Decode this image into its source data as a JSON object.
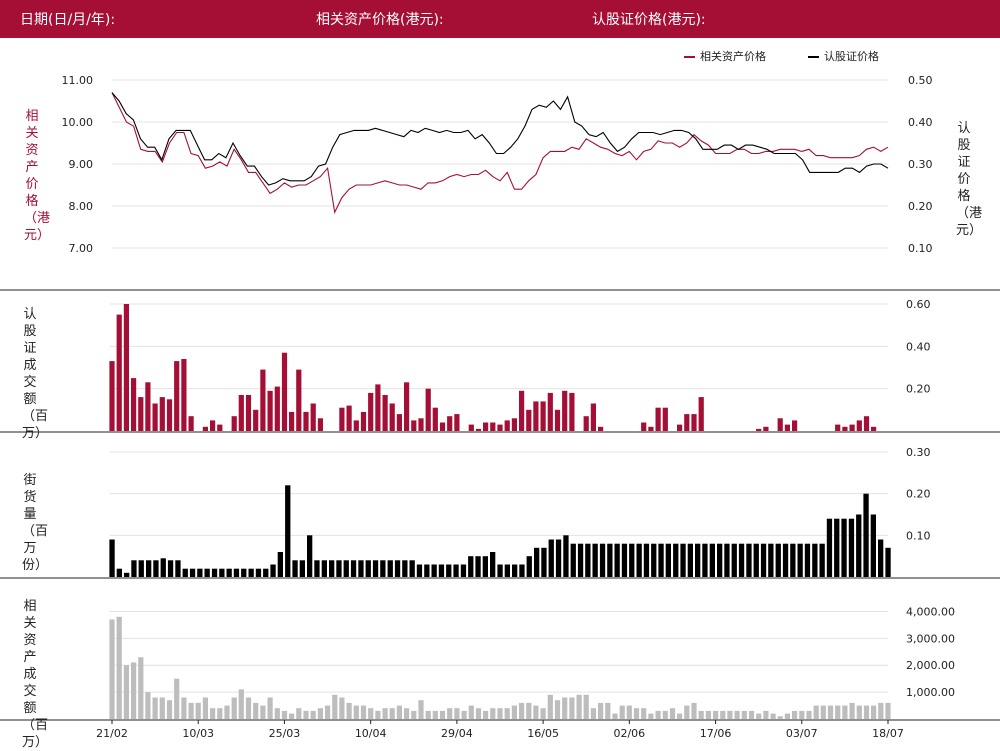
{
  "header": {
    "date_label": "日期(日/月/年):",
    "asset_label": "相关资产价格(港元):",
    "warrant_label": "认股证价格(港元):"
  },
  "legend": {
    "asset": "相关资产价格",
    "warrant": "认股证价格"
  },
  "colors": {
    "brand": "#a50f35",
    "asset": "#a50f35",
    "warrant": "#000000",
    "turnover_asset": "#bdbdbd"
  },
  "axis_titles": {
    "price_left": "相关资产价格（港元）",
    "price_right": "认股证价格（港元）",
    "warrant_volume": "认股证成交额（百万）",
    "outstanding": "街货量（百万份）",
    "asset_volume": "相关资产成交额（百万）"
  },
  "chart_data": [
    {
      "type": "line",
      "title": "",
      "x_ticks": [
        "21/02",
        "10/03",
        "25/03",
        "10/04",
        "29/04",
        "16/05",
        "02/06",
        "17/06",
        "03/07",
        "18/07"
      ],
      "ylim_left": [
        7,
        11
      ],
      "ylim_right": [
        0.1,
        0.5
      ],
      "yticks_left": [
        "11.00",
        "10.00",
        "9.00",
        "8.00",
        "7.00"
      ],
      "yticks_right": [
        "0.50",
        "0.40",
        "0.30",
        "0.20",
        "0.10"
      ],
      "series": [
        {
          "name": "相关资产价格",
          "axis": "left",
          "values": [
            10.7,
            10.35,
            10.0,
            9.9,
            9.35,
            9.3,
            9.3,
            9.05,
            9.5,
            9.75,
            9.75,
            9.25,
            9.2,
            8.9,
            8.95,
            9.05,
            8.95,
            9.35,
            9.1,
            8.8,
            8.8,
            8.55,
            8.3,
            8.4,
            8.55,
            8.45,
            8.5,
            8.5,
            8.6,
            8.7,
            8.9,
            7.85,
            8.2,
            8.4,
            8.5,
            8.5,
            8.5,
            8.55,
            8.6,
            8.55,
            8.5,
            8.5,
            8.45,
            8.4,
            8.55,
            8.55,
            8.6,
            8.7,
            8.75,
            8.7,
            8.75,
            8.75,
            8.85,
            8.7,
            8.6,
            8.8,
            8.4,
            8.4,
            8.6,
            8.75,
            9.15,
            9.3,
            9.3,
            9.3,
            9.4,
            9.35,
            9.6,
            9.5,
            9.4,
            9.35,
            9.25,
            9.2,
            9.3,
            9.1,
            9.3,
            9.35,
            9.55,
            9.5,
            9.5,
            9.4,
            9.5,
            9.7,
            9.55,
            9.45,
            9.25,
            9.25,
            9.25,
            9.35,
            9.35,
            9.25,
            9.25,
            9.3,
            9.3,
            9.35,
            9.35,
            9.35,
            9.3,
            9.35,
            9.2,
            9.2,
            9.15,
            9.15,
            9.15,
            9.15,
            9.2,
            9.35,
            9.4,
            9.3,
            9.4
          ]
        },
        {
          "name": "认股证价格",
          "axis": "right",
          "values": [
            0.47,
            0.45,
            0.42,
            0.405,
            0.36,
            0.34,
            0.34,
            0.31,
            0.36,
            0.38,
            0.38,
            0.38,
            0.345,
            0.31,
            0.31,
            0.325,
            0.315,
            0.35,
            0.32,
            0.295,
            0.295,
            0.27,
            0.25,
            0.255,
            0.265,
            0.26,
            0.26,
            0.26,
            0.27,
            0.295,
            0.3,
            0.34,
            0.37,
            0.375,
            0.38,
            0.38,
            0.38,
            0.385,
            0.38,
            0.375,
            0.37,
            0.365,
            0.38,
            0.375,
            0.385,
            0.38,
            0.375,
            0.38,
            0.375,
            0.375,
            0.38,
            0.36,
            0.37,
            0.35,
            0.325,
            0.325,
            0.34,
            0.36,
            0.39,
            0.43,
            0.44,
            0.435,
            0.45,
            0.43,
            0.46,
            0.4,
            0.39,
            0.37,
            0.365,
            0.375,
            0.35,
            0.33,
            0.34,
            0.36,
            0.375,
            0.375,
            0.375,
            0.37,
            0.375,
            0.38,
            0.38,
            0.375,
            0.36,
            0.335,
            0.335,
            0.335,
            0.345,
            0.345,
            0.335,
            0.345,
            0.345,
            0.34,
            0.335,
            0.325,
            0.325,
            0.325,
            0.325,
            0.31,
            0.28,
            0.28,
            0.28,
            0.28,
            0.28,
            0.29,
            0.29,
            0.28,
            0.295,
            0.3,
            0.3,
            0.29
          ]
        }
      ]
    },
    {
      "type": "bar",
      "title": "",
      "ylabel": "认股证成交额（百万）",
      "ylim": [
        0,
        0.6
      ],
      "yticks": [
        "0.60",
        "0.40",
        "0.20"
      ],
      "values": [
        0.33,
        0.55,
        0.6,
        0.25,
        0.16,
        0.23,
        0.13,
        0.16,
        0.15,
        0.33,
        0.34,
        0.07,
        0,
        0.02,
        0.05,
        0.03,
        0,
        0.07,
        0.17,
        0.17,
        0.1,
        0.29,
        0.19,
        0.21,
        0.37,
        0.09,
        0.29,
        0.09,
        0.13,
        0.06,
        0,
        0,
        0.11,
        0.12,
        0.05,
        0.09,
        0.18,
        0.22,
        0.17,
        0.13,
        0.08,
        0.23,
        0.05,
        0.06,
        0.2,
        0.11,
        0.04,
        0.07,
        0.08,
        0,
        0.03,
        0.01,
        0.04,
        0.04,
        0.03,
        0.05,
        0.06,
        0.19,
        0.1,
        0.14,
        0.14,
        0.18,
        0.1,
        0.19,
        0.18,
        0,
        0.07,
        0.13,
        0.02,
        0,
        0,
        0,
        0,
        0,
        0.04,
        0.02,
        0.11,
        0.11,
        0,
        0.03,
        0.08,
        0.08,
        0.16,
        0,
        0,
        0,
        0,
        0,
        0,
        0,
        0.01,
        0.02,
        0,
        0.06,
        0.03,
        0.05,
        0,
        0,
        0,
        0,
        0,
        0.03,
        0.02,
        0.03,
        0.05,
        0.07,
        0.02,
        0,
        0
      ]
    },
    {
      "type": "bar",
      "title": "",
      "ylabel": "街货量（百万份）",
      "ylim": [
        0,
        0.3
      ],
      "yticks": [
        "0.30",
        "0.20",
        "0.10"
      ],
      "values": [
        0.09,
        0.02,
        0.01,
        0.04,
        0.04,
        0.04,
        0.04,
        0.045,
        0.04,
        0.04,
        0.02,
        0.02,
        0.02,
        0.02,
        0.02,
        0.02,
        0.02,
        0.02,
        0.02,
        0.02,
        0.02,
        0.02,
        0.03,
        0.06,
        0.22,
        0.04,
        0.04,
        0.1,
        0.04,
        0.04,
        0.04,
        0.04,
        0.04,
        0.04,
        0.04,
        0.04,
        0.04,
        0.04,
        0.04,
        0.04,
        0.04,
        0.04,
        0.03,
        0.03,
        0.03,
        0.03,
        0.03,
        0.03,
        0.03,
        0.05,
        0.05,
        0.05,
        0.06,
        0.03,
        0.03,
        0.03,
        0.03,
        0.05,
        0.07,
        0.07,
        0.09,
        0.09,
        0.1,
        0.08,
        0.08,
        0.08,
        0.08,
        0.08,
        0.08,
        0.08,
        0.08,
        0.08,
        0.08,
        0.08,
        0.08,
        0.08,
        0.08,
        0.08,
        0.08,
        0.08,
        0.08,
        0.08,
        0.08,
        0.08,
        0.08,
        0.08,
        0.08,
        0.08,
        0.08,
        0.08,
        0.08,
        0.08,
        0.08,
        0.08,
        0.08,
        0.08,
        0.08,
        0.08,
        0.14,
        0.14,
        0.14,
        0.14,
        0.15,
        0.2,
        0.15,
        0.09,
        0.07
      ]
    },
    {
      "type": "bar",
      "title": "",
      "ylabel": "相关资产成交额（百万）",
      "ylim": [
        0,
        4500
      ],
      "yticks": [
        "4,000.00",
        "3,000.00",
        "2,000.00",
        "1,000.00"
      ],
      "values": [
        3700,
        3800,
        2000,
        2100,
        2300,
        1000,
        800,
        800,
        700,
        1500,
        800,
        600,
        600,
        800,
        400,
        400,
        500,
        800,
        1100,
        800,
        600,
        500,
        800,
        400,
        300,
        200,
        400,
        300,
        300,
        400,
        500,
        900,
        800,
        600,
        500,
        500,
        400,
        300,
        400,
        400,
        500,
        400,
        300,
        700,
        300,
        300,
        300,
        400,
        400,
        300,
        500,
        400,
        300,
        400,
        400,
        400,
        500,
        600,
        600,
        500,
        400,
        900,
        700,
        800,
        800,
        900,
        900,
        400,
        600,
        600,
        200,
        500,
        500,
        400,
        400,
        200,
        300,
        300,
        400,
        200,
        500,
        600,
        300,
        300,
        300,
        300,
        300,
        300,
        300,
        300,
        200,
        300,
        200,
        100,
        200,
        300,
        300,
        300,
        500,
        500,
        500,
        500,
        500,
        600,
        500,
        500,
        500,
        600,
        600
      ]
    }
  ]
}
